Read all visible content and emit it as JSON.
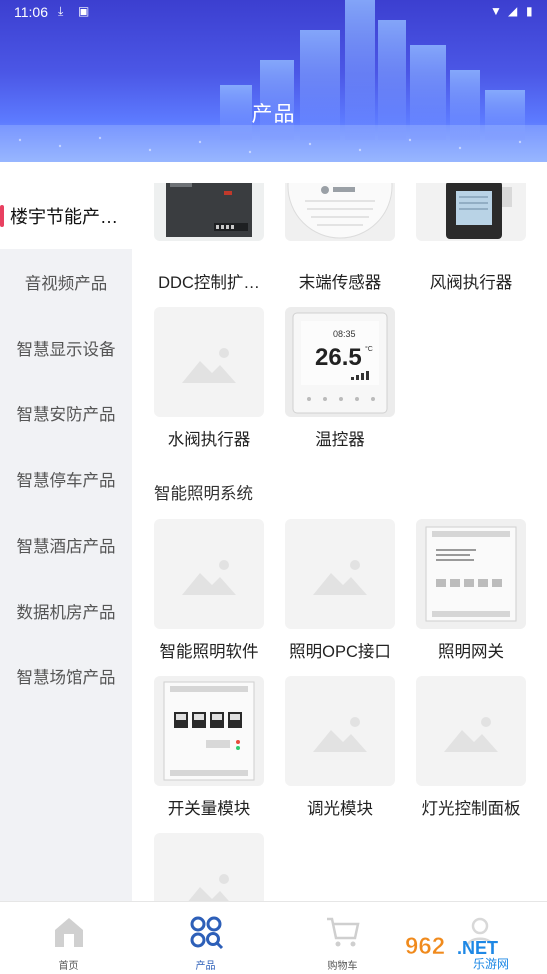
{
  "status_bar": {
    "time": "11:06"
  },
  "header": {
    "title": "产品"
  },
  "sidebar": {
    "items": [
      {
        "label": "楼宇节能产…",
        "active": true
      },
      {
        "label": "音视频产品"
      },
      {
        "label": "智慧显示设备"
      },
      {
        "label": "智慧安防产品"
      },
      {
        "label": "智慧停车产品"
      },
      {
        "label": "智慧酒店产品"
      },
      {
        "label": "数据机房产品"
      },
      {
        "label": "智慧场馆产品"
      }
    ]
  },
  "content": {
    "group1": {
      "products": [
        {
          "label": "DDC控制扩…",
          "icon": "ddc-module-image"
        },
        {
          "label": "末端传感器",
          "icon": "sensor-image"
        },
        {
          "label": "风阀执行器",
          "icon": "damper-actuator-image"
        },
        {
          "label": "水阀执行器",
          "icon": "image-placeholder-icon"
        },
        {
          "label": "温控器",
          "icon": "thermostat-image"
        }
      ],
      "thermostat_display": {
        "temp": "26.5",
        "unit": "°C",
        "time": "08:35"
      }
    },
    "group2": {
      "title": "智能照明系统",
      "products": [
        {
          "label": "智能照明软件",
          "icon": "image-placeholder-icon"
        },
        {
          "label": "照明OPC接口",
          "icon": "image-placeholder-icon"
        },
        {
          "label": "照明网关",
          "icon": "gateway-image"
        },
        {
          "label": "开关量模块",
          "icon": "switch-module-image"
        },
        {
          "label": "调光模块",
          "icon": "image-placeholder-icon"
        },
        {
          "label": "灯光控制面板",
          "icon": "image-placeholder-icon"
        },
        {
          "label": "",
          "icon": "image-placeholder-icon"
        }
      ]
    }
  },
  "bottom_nav": {
    "items": [
      {
        "label": "首页",
        "icon": "home-icon"
      },
      {
        "label": "产品",
        "icon": "products-grid-icon",
        "active": true
      },
      {
        "label": "购物车",
        "icon": "cart-icon"
      },
      {
        "label": "",
        "icon": "profile-icon"
      }
    ]
  },
  "watermark": {
    "text": "962.NET",
    "subtext": "乐游网"
  },
  "colors": {
    "accent": "#2d5fb8",
    "active_bar": "#e84060",
    "header": "#4b57e6"
  }
}
